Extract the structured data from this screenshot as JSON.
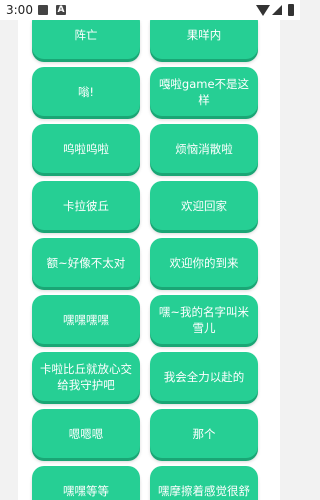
{
  "status_bar": {
    "time": "3:00",
    "notification_icons": [
      "image-icon",
      "a-icon"
    ],
    "a_icon_letter": "A",
    "right_icons": [
      "wifi-icon",
      "signal-icon",
      "battery-icon"
    ]
  },
  "buttons": [
    [
      "阵亡",
      "果咩内"
    ],
    [
      "嗡!",
      "嘎啦game不是这样"
    ],
    [
      "呜啦呜啦",
      "烦恼消散啦"
    ],
    [
      "卡拉彼丘",
      "欢迎回家"
    ],
    [
      "额~好像不太对",
      "欢迎你的到来"
    ],
    [
      "嘿嘿嘿嘿",
      "嘿~我的名字叫米雪儿"
    ],
    [
      "卡啦比丘就放心交给我守护吧",
      "我会全力以赴的"
    ],
    [
      "嗯嗯嗯",
      "那个"
    ],
    [
      "嘿嘿等等",
      "嘿摩擦着感觉很舒"
    ]
  ],
  "colors": {
    "button": "#26cf94",
    "button_shadow": "#1aa675",
    "background": "#f2f2f2",
    "panel": "#ffffff"
  }
}
